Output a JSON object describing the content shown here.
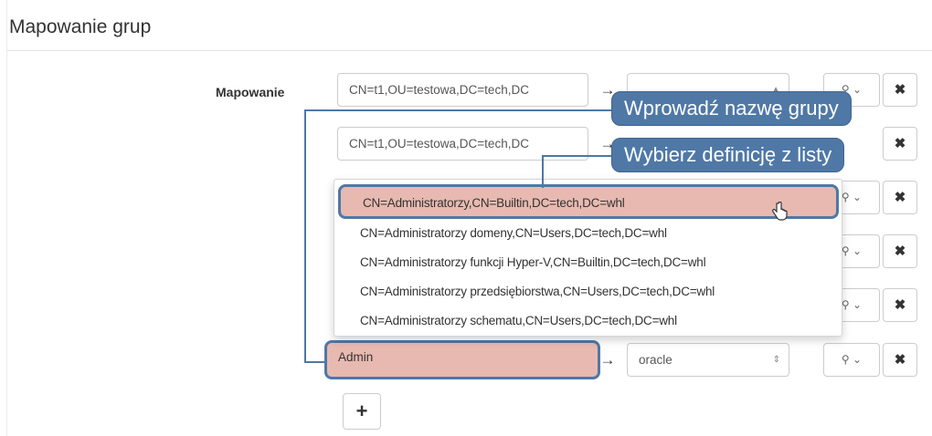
{
  "section": {
    "title": "Mapowanie grup"
  },
  "mapping": {
    "label": "Mapowanie",
    "rows": [
      {
        "value": "CN=t1,OU=testowa,DC=tech,DC",
        "arrow": "→",
        "target": "",
        "delete": "✖"
      },
      {
        "value": "CN=t1,OU=testowa,DC=tech,DC",
        "arrow": "→",
        "target": "",
        "delete": "✖"
      },
      {
        "value": "",
        "arrow": "",
        "target": "",
        "delete": "✖"
      },
      {
        "value": "",
        "arrow": "",
        "target": "",
        "delete": "✖"
      },
      {
        "value": "",
        "arrow": "",
        "target": "",
        "delete": "✖"
      },
      {
        "value": "Admin",
        "arrow": "→",
        "target": "oracle",
        "delete": "✖"
      }
    ],
    "add_label": "+"
  },
  "dropdown": {
    "items": [
      "CN=Administratorzy,CN=Builtin,DC=tech,DC=whl",
      "CN=Administratorzy domeny,CN=Users,DC=tech,DC=whl",
      "CN=Administratorzy funkcji Hyper-V,CN=Builtin,DC=tech,DC=whl",
      "CN=Administratorzy przedsiębiorstwa,CN=Users,DC=tech,DC=whl",
      "CN=Administratorzy schematu,CN=Users,DC=tech,DC=whl"
    ],
    "highlighted_index": 0
  },
  "callouts": {
    "input_hint": "Wprowadź nazwę grupy",
    "select_hint": "Wybierz definicję z listy"
  },
  "icons": {
    "key": "key-icon",
    "delete": "close-icon",
    "arrow": "arrow-right-icon",
    "pointer": "hand-cursor-icon"
  },
  "colors": {
    "callout": "#4f78a6",
    "highlight": "#e8b9b0",
    "border": "#cccccc"
  }
}
